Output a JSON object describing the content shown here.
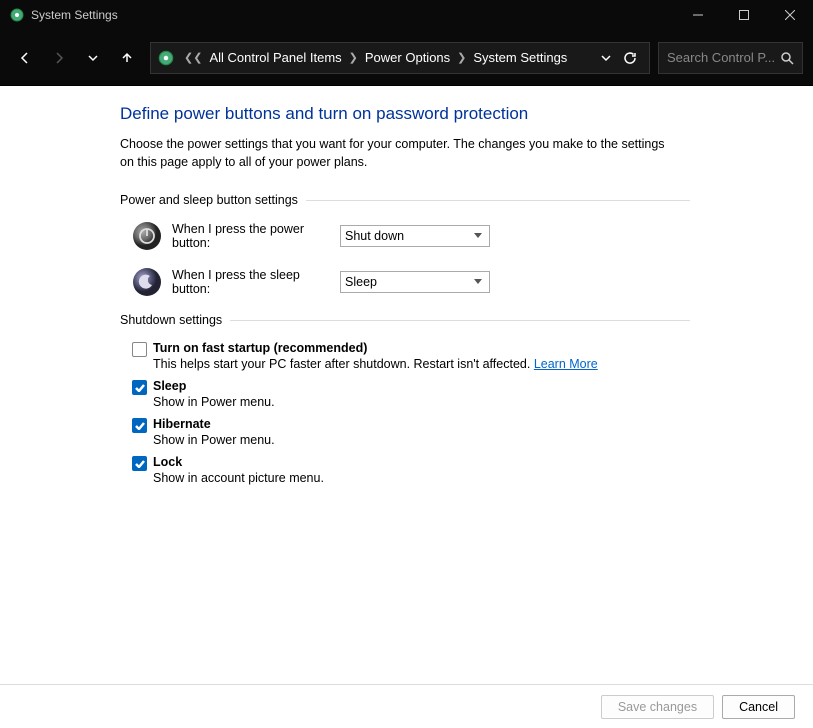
{
  "window": {
    "title": "System Settings"
  },
  "breadcrumb": {
    "items": [
      "All Control Panel Items",
      "Power Options",
      "System Settings"
    ]
  },
  "search": {
    "placeholder": "Search Control P..."
  },
  "page": {
    "title": "Define power buttons and turn on password protection",
    "description": "Choose the power settings that you want for your computer. The changes you make to the settings on this page apply to all of your power plans."
  },
  "sections": {
    "power_sleep": {
      "header": "Power and sleep button settings",
      "power_button_label": "When I press the power button:",
      "power_button_value": "Shut down",
      "sleep_button_label": "When I press the sleep button:",
      "sleep_button_value": "Sleep"
    },
    "shutdown": {
      "header": "Shutdown settings",
      "fast_startup": {
        "label": "Turn on fast startup (recommended)",
        "desc": "This helps start your PC faster after shutdown. Restart isn't affected. ",
        "link": "Learn More"
      },
      "sleep": {
        "label": "Sleep",
        "desc": "Show in Power menu."
      },
      "hibernate": {
        "label": "Hibernate",
        "desc": "Show in Power menu."
      },
      "lock": {
        "label": "Lock",
        "desc": "Show in account picture menu."
      }
    }
  },
  "footer": {
    "save": "Save changes",
    "cancel": "Cancel"
  }
}
